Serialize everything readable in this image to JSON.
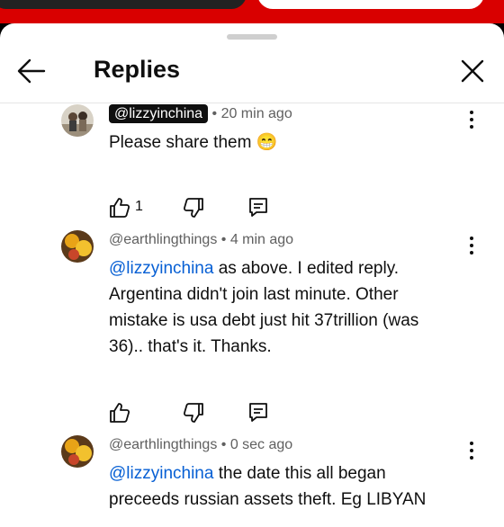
{
  "header": {
    "title": "Replies"
  },
  "comments": [
    {
      "author": "@lizzyinchina",
      "time": "• 20 min ago",
      "text": "Please share them 😁",
      "like_count": "1"
    },
    {
      "author": "@earthlingthings",
      "time": "• 4 min ago",
      "mention": "@lizzyinchina",
      "text_line1": " as above. I edited reply.",
      "text_line2": "Argentina didn't join last minute. Other",
      "text_line3": "mistake is usa debt just hit 37trillion (was",
      "text_line4": "36).. that's it. Thanks."
    },
    {
      "author": "@earthlingthings",
      "time": "• 0 sec ago",
      "mention": "@lizzyinchina",
      "text_line1": " the date this all began",
      "text_line2": "preceeds russian assets theft. Eg LIBYAN"
    }
  ],
  "icons": {
    "back": "arrow-left-icon",
    "close": "close-icon",
    "more": "more-vert-icon",
    "like": "thumb-up-icon",
    "dislike": "thumb-down-icon",
    "reply": "reply-icon"
  },
  "colors": {
    "mention": "#065fd4",
    "meta": "#606060",
    "text": "#0f0f0f"
  }
}
